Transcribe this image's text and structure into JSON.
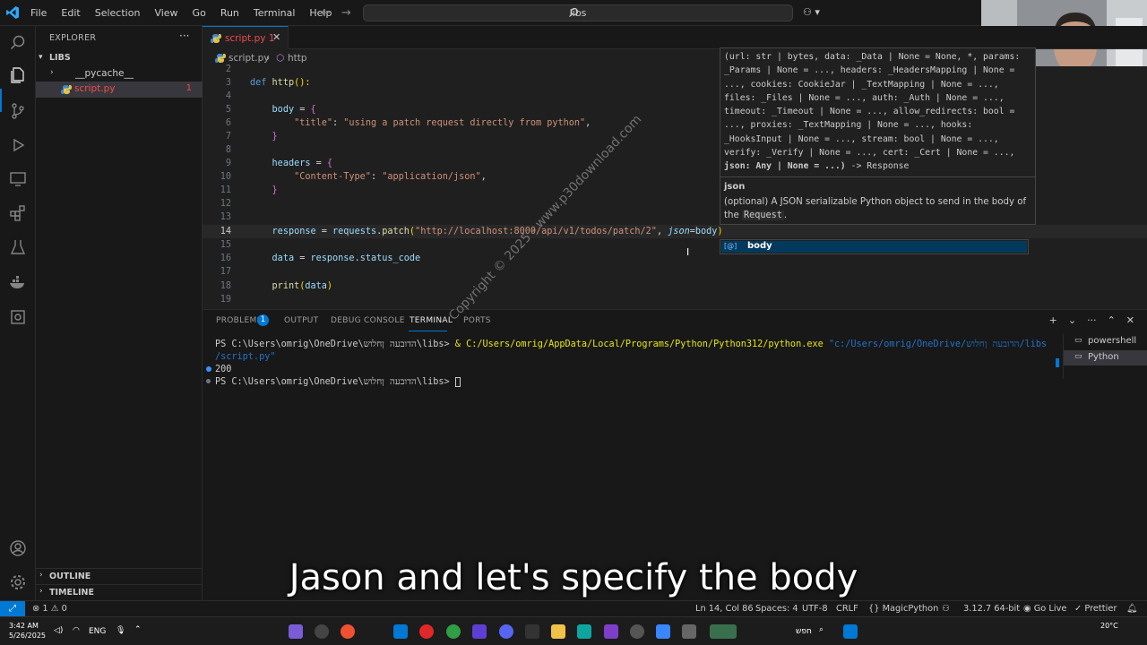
{
  "window": {
    "menu": [
      "File",
      "Edit",
      "Selection",
      "View",
      "Go",
      "Run",
      "Terminal",
      "Help"
    ],
    "search_text": "libs"
  },
  "sidebar": {
    "title": "EXPLORER",
    "root": "LIBS",
    "items": [
      {
        "label": "__pycache__",
        "type": "folder"
      },
      {
        "label": "script.py",
        "type": "file",
        "badge": "1"
      }
    ],
    "outline": "OUTLINE",
    "timeline": "TIMELINE"
  },
  "editor": {
    "tab": {
      "label": "script.py",
      "badge": "1"
    },
    "breadcrumb": {
      "file": "script.py",
      "symbol": "http",
      "sep": "›"
    },
    "lines": [
      {
        "n": "2",
        "code": ""
      },
      {
        "n": "3",
        "code": "def http():"
      },
      {
        "n": "4",
        "code": ""
      },
      {
        "n": "5",
        "code": "    body = {"
      },
      {
        "n": "6",
        "code": "        \"title\": \"using a patch request directly from python\","
      },
      {
        "n": "7",
        "code": "    }"
      },
      {
        "n": "8",
        "code": ""
      },
      {
        "n": "9",
        "code": "    headers = {"
      },
      {
        "n": "10",
        "code": "        \"Content-Type\": \"application/json\","
      },
      {
        "n": "11",
        "code": "    }"
      },
      {
        "n": "12",
        "code": ""
      },
      {
        "n": "13",
        "code": ""
      },
      {
        "n": "14",
        "code": "    response = requests.patch(\"http://localhost:8000/api/v1/todos/patch/2\", json=body)"
      },
      {
        "n": "15",
        "code": ""
      },
      {
        "n": "16",
        "code": "    data = response.status_code"
      },
      {
        "n": "17",
        "code": ""
      },
      {
        "n": "18",
        "code": "    print(data)"
      },
      {
        "n": "19",
        "code": ""
      }
    ],
    "tokens": {
      "def": "def",
      "http_fn": "http",
      "parens": "():",
      "body": "body",
      "eq": " = ",
      "lbrace": "{",
      "rbrace": "}",
      "title_key": "\"title\"",
      "colon": ": ",
      "title_val": "\"using a patch request directly from python\"",
      "comma": ",",
      "headers": "headers",
      "ct_key": "\"Content-Type\"",
      "ct_val": "\"application/json\"",
      "response": "response",
      "requests": "requests",
      "dot": ".",
      "patch": "patch",
      "lparen": "(",
      "rparen": ")",
      "url": "\"http://localhost:8000/api/v1/todos/patch/2\"",
      "json_kw": "json",
      "body_arg": "body",
      "data": "data",
      "status_code": "status_code",
      "print": "print",
      "data_arg": "data",
      "indent4": "    ",
      "indent8": "        "
    },
    "hover": {
      "signature": "(url: str | bytes, data: _Data | None = None, *, params: _Params | None = ..., headers: _HeadersMapping | None = ..., cookies: CookieJar | _TextMapping | None = ..., files: _Files | None = ..., auth: _Auth | None = ..., timeout: _Timeout | None = ..., allow_redirects: bool = ..., proxies: _TextMapping | None = ..., hooks: _HooksInput | None = ..., stream: bool | None = ..., verify: _Verify | None = ..., cert: _Cert | None = ...,",
      "signature_bold": "json: Any | None = ...)",
      "signature_tail": " -> Response",
      "param_name": "json",
      "param_desc": "(optional) A JSON serializable Python object to send in the body of the",
      "param_code": "Request",
      "param_end": "."
    },
    "suggestion": {
      "label": "body",
      "kind": "[@]"
    }
  },
  "panel": {
    "tabs": [
      "PROBLEMS",
      "OUTPUT",
      "DEBUG CONSOLE",
      "TERMINAL",
      "PORTS"
    ],
    "problems_badge": "1",
    "terminal": {
      "line1_prompt": "PS C:\\Users\\omrig\\OneDrive\\הדובעה ןחלוש\\libs> ",
      "line1_cmd": "& C:/Users/omrig/AppData/Local/Programs/Python/Python312/python.exe",
      "line1_path": " \"c:/Users/omrig/OneDrive/הדובעה ןחלוש/libs",
      "line2": "/script.py\"",
      "line3": "200",
      "line4": "PS C:\\Users\\omrig\\OneDrive\\הדובעה ןחלוש\\libs> "
    },
    "terminals": [
      "powershell",
      "Python"
    ]
  },
  "overlay": {
    "watermark": "Copyright © 2025 - www.p30download.com",
    "subtitle": "Jason and let's specify the body"
  },
  "statusbar": {
    "errors": "1",
    "warnings": "0",
    "position": "Ln 14, Col 86",
    "spaces": "Spaces: 4",
    "encoding": "UTF-8",
    "eol": "CRLF",
    "language": "{} MagicPython",
    "interpreter": "3.12.7 64-bit",
    "golive": "Go Live",
    "prettier": "Prettier"
  },
  "taskbar": {
    "time": "3:42 AM",
    "date": "5/26/2025",
    "lang": "ENG",
    "search": "חפש",
    "weather": "20°C"
  },
  "colors": {
    "accent": "#0078d4",
    "error": "#f14c4c",
    "background": "#1f1f1f"
  }
}
